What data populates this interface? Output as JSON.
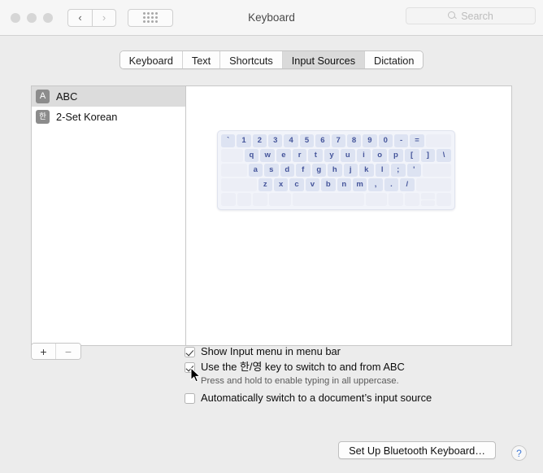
{
  "window": {
    "title": "Keyboard",
    "traffic_lights": [
      "close",
      "minimize",
      "zoom"
    ],
    "nav": {
      "back": "‹",
      "forward": "›",
      "grid_icon": "grid-all-preferences-icon"
    },
    "search": {
      "placeholder": "Search",
      "value": "",
      "icon": "search-icon"
    }
  },
  "tabs": [
    {
      "label": "Keyboard",
      "selected": false
    },
    {
      "label": "Text",
      "selected": false
    },
    {
      "label": "Shortcuts",
      "selected": false
    },
    {
      "label": "Input Sources",
      "selected": true
    },
    {
      "label": "Dictation",
      "selected": false
    }
  ],
  "input_sources": [
    {
      "badge": "A",
      "label": "ABC",
      "selected": true
    },
    {
      "badge": "한",
      "label": "2-Set Korean",
      "selected": false
    }
  ],
  "list_controls": {
    "add": "+",
    "remove": "−"
  },
  "keyboard_preview": {
    "rows": [
      [
        "`",
        "1",
        "2",
        "3",
        "4",
        "5",
        "6",
        "7",
        "8",
        "9",
        "0",
        "-",
        "=",
        ""
      ],
      [
        "",
        "q",
        "w",
        "e",
        "r",
        "t",
        "y",
        "u",
        "i",
        "o",
        "p",
        "[",
        "]",
        "\\"
      ],
      [
        "",
        "a",
        "s",
        "d",
        "f",
        "g",
        "h",
        "j",
        "k",
        "l",
        ";",
        "'",
        ""
      ],
      [
        "",
        "z",
        "x",
        "c",
        "v",
        "b",
        "n",
        "m",
        ",",
        ".",
        "/",
        ""
      ],
      [
        "",
        "",
        "",
        "",
        "",
        "",
        "",
        "",
        ""
      ]
    ],
    "key_color": "#dde3f2",
    "key_text_color": "#44549a",
    "background_color": "#f2f4fa"
  },
  "options": [
    {
      "label": "Show Input menu in menu bar",
      "checked": true,
      "note": ""
    },
    {
      "label": "Use the 한/영 key to switch to and from ABC",
      "checked": true,
      "note": "Press and hold to enable typing in all uppercase."
    },
    {
      "label": "Automatically switch to a document’s input source",
      "checked": false,
      "note": ""
    }
  ],
  "footer": {
    "bluetooth_button": "Set Up Bluetooth Keyboard…",
    "help_button": "?",
    "help_icon": "question-mark-icon"
  },
  "colors": {
    "window_bg": "#ececec",
    "titlebar_bg": "#f6f6f6",
    "pane_bg": "#ffffff",
    "selection": "#dcdcdc",
    "accent_blue": "#3f79d8"
  }
}
